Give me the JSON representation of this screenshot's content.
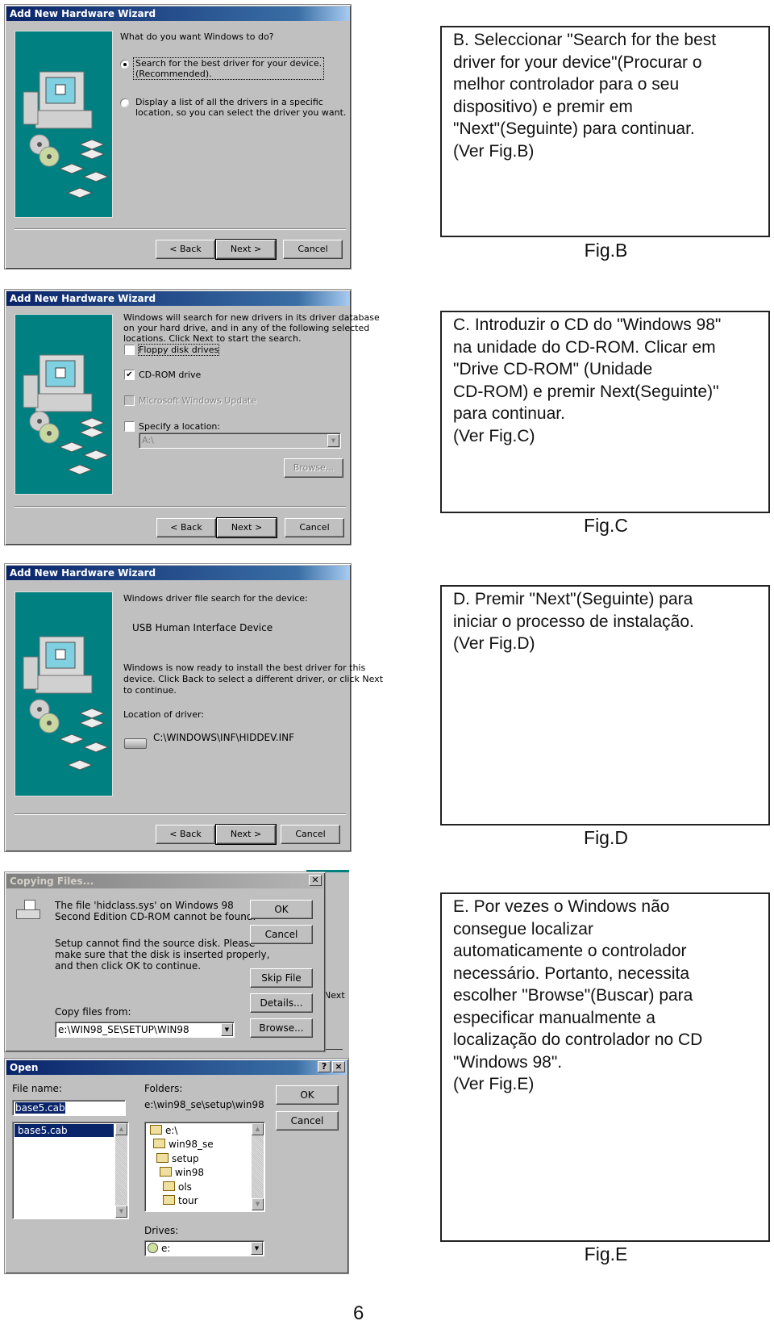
{
  "page_number": "6",
  "colors": {
    "teal": "#008080",
    "titlebar": "#0a246a",
    "dialog_gray": "#c0c0c0"
  },
  "figB": {
    "window_title": "Add New Hardware Wizard",
    "prompt": "What do you want Windows to do?",
    "option1_line1": "Search for the best driver for your device.",
    "option1_line2": "(Recommended).",
    "option1_selected": true,
    "option2_line1": "Display a list of all the drivers in a specific",
    "option2_line2": "location, so you can select the driver you want.",
    "buttons": {
      "back": "< Back",
      "next": "Next >",
      "cancel": "Cancel"
    },
    "instruction": [
      "B. Seleccionar \"Search for the best",
      "driver for your device\"(Procurar o",
      "melhor controlador para o seu",
      "dispositivo) e premir em",
      "\"Next\"(Seguinte) para continuar.",
      "(Ver Fig.B)"
    ],
    "caption": "Fig.B"
  },
  "figC": {
    "window_title": "Add New Hardware Wizard",
    "intro": [
      "Windows will search for new drivers in its driver database",
      "on your hard drive, and in any of the following selected",
      "locations. Click Next to start the search."
    ],
    "checkboxes": [
      {
        "label": "Floppy disk drives",
        "checked": false,
        "disabled": false
      },
      {
        "label": "CD-ROM drive",
        "checked": true,
        "disabled": false
      },
      {
        "label": "Microsoft Windows Update",
        "checked": false,
        "disabled": true
      },
      {
        "label": "Specify a location:",
        "checked": false,
        "disabled": false
      }
    ],
    "location_value": "A:\\",
    "browse": "Browse...",
    "buttons": {
      "back": "< Back",
      "next": "Next >",
      "cancel": "Cancel"
    },
    "instruction": [
      "C. Introduzir o CD do \"Windows 98\"",
      "na unidade do CD-ROM. Clicar em",
      "\"Drive CD-ROM\" (Unidade",
      "CD-ROM) e premir Next(Seguinte)\"",
      "para continuar.",
      "(Ver Fig.C)"
    ],
    "caption": "Fig.C"
  },
  "figD": {
    "window_title": "Add New Hardware Wizard",
    "search_label": "Windows driver file search for the device:",
    "device": "USB Human Interface Device",
    "ready": [
      "Windows is now ready to install the best driver for this",
      "device. Click Back to select a different driver, or click Next",
      "to continue."
    ],
    "location_label": "Location of driver:",
    "driver_path": "C:\\WINDOWS\\INF\\HIDDEV.INF",
    "buttons": {
      "back": "< Back",
      "next": "Next >",
      "cancel": "Cancel"
    },
    "instruction": [
      "D. Premir \"Next\"(Seguinte) para",
      "iniciar o processo de instalação.",
      "(Ver Fig.D)"
    ],
    "caption": "Fig.D"
  },
  "figE": {
    "copying": {
      "title": "Copying Files...",
      "message1": [
        "The file 'hidclass.sys' on Windows 98",
        "Second Edition CD-ROM cannot be found."
      ],
      "message2": [
        "Setup cannot find the source disk. Please",
        "make sure that the disk is inserted properly,",
        "and then click OK to continue."
      ],
      "copy_from_label": "Copy files from:",
      "copy_from_value": "e:\\WIN98_SE\\SETUP\\WIN98",
      "buttons": {
        "ok": "OK",
        "cancel": "Cancel",
        "skip": "Skip File",
        "details": "Details...",
        "browse": "Browse..."
      },
      "background_text": "Next"
    },
    "open": {
      "title": "Open",
      "file_name_label": "File name:",
      "file_name_value": "base5.cab",
      "files": [
        "base5.cab"
      ],
      "folders_label": "Folders:",
      "folders_path": "e:\\win98_se\\setup\\win98",
      "folders": [
        "e:\\",
        "win98_se",
        "setup",
        "win98",
        "ols",
        "tour"
      ],
      "drives_label": "Drives:",
      "drive_value": "e:",
      "buttons": {
        "ok": "OK",
        "cancel": "Cancel",
        "help": "?",
        "close": "×"
      }
    },
    "instruction": [
      "E. Por vezes o Windows não",
      "consegue localizar",
      "automaticamente o controlador",
      "necessário. Portanto, necessita",
      "escolher \"Browse\"(Buscar) para",
      "especificar manualmente a",
      "localização do controlador no CD",
      "\"Windows 98\".",
      "(Ver Fig.E)"
    ],
    "caption": "Fig.E"
  }
}
